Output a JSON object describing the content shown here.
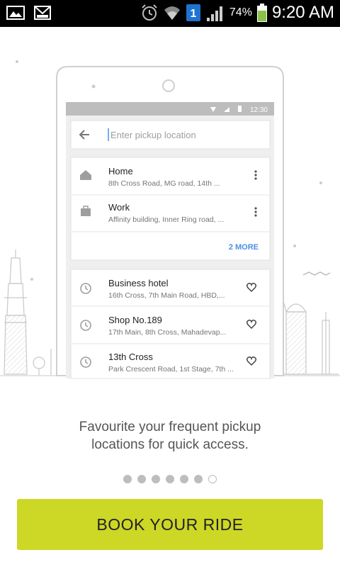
{
  "status_bar": {
    "time": "9:20 AM",
    "battery": "74%",
    "notif_badge": "1"
  },
  "mock_phone": {
    "clock": "12:30",
    "search_placeholder": "Enter pickup location",
    "saved": [
      {
        "title": "Home",
        "subtitle": "8th Cross Road, MG road, 14th ..."
      },
      {
        "title": "Work",
        "subtitle": "Affinity building, Inner Ring road, ..."
      }
    ],
    "more_label": "2 MORE",
    "recent": [
      {
        "title": "Business hotel",
        "subtitle": "16th Cross, 7th Main Road, HBD,..."
      },
      {
        "title": "Shop No.189",
        "subtitle": "17th Main, 8th Cross, Mahadevap..."
      },
      {
        "title": "13th Cross",
        "subtitle": "Park Crescent Road, 1st Stage, 7th ..."
      }
    ]
  },
  "caption": {
    "line1": "Favourite your frequent pickup",
    "line2": "locations for quick access."
  },
  "pager": {
    "total": 7,
    "active_index": 6
  },
  "cta_label": "BOOK YOUR RIDE",
  "colors": {
    "accent": "#cdd726",
    "link_blue": "#4a90e2"
  }
}
